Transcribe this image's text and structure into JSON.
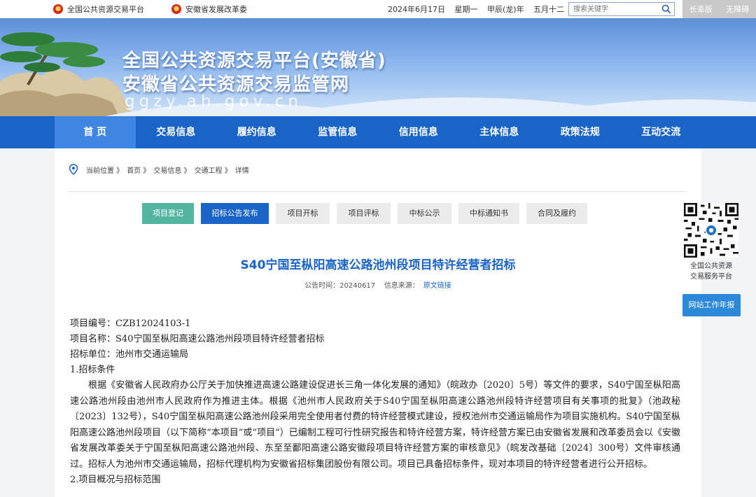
{
  "topbar": {
    "link1": "全国公共资源交易平台",
    "link2": "安徽省发展改革委",
    "date": "2024年6月17日 星期一 甲辰(龙)年 五月十二",
    "search_placeholder": "搜索关键字",
    "elder": "长辈版",
    "accessible": "无障碍"
  },
  "banner": {
    "title1": "全国公共资源交易平台(安徽省)",
    "title2": "安徽省公共资源交易监管网",
    "domain": "ggzy.ah.gov.cn"
  },
  "nav": [
    "首 页",
    "交易信息",
    "履约信息",
    "监管信息",
    "信用信息",
    "主体信息",
    "政策法规",
    "互动交流"
  ],
  "breadcrumb": [
    "当前位置 》",
    "首页 》",
    "交易信息 》",
    "交通工程 》",
    "详情"
  ],
  "steps": [
    "项目登记",
    "招标公告发布",
    "项目开标",
    "项目评标",
    "中标公示",
    "中标通知书",
    "合同及履约"
  ],
  "article": {
    "title": "S40宁国至枞阳高速公路池州段项目特许经营者招标",
    "pub_label": "公告时间：20240617",
    "source_label": "信息来源：",
    "source_link": "原文链接",
    "project_no": "项目编号：CZB12024103-1",
    "project_name": "项目名称：S40宁国至枞阳高速公路池州段项目特许经营者招标",
    "tenderer": "招标单位：池州市交通运输局",
    "section1": "1.招标条件",
    "para1": "根据《安徽省人民政府办公厅关于加快推进高速公路建设促进长三角一体化发展的通知》（皖政办〔2020〕5号）等文件的要求，S40宁国至枞阳高速公路池州段由池州市人民政府作为推进主体。根据《池州市人民政府关于S40宁国至枞阳高速公路池州段特许经营项目有关事项的批复》（池政秘〔2023〕132号），S40宁国至枞阳高速公路池州段采用完全使用者付费的特许经营模式建设，授权池州市交通运输局作为项目实施机构。S40宁国至枞阳高速公路池州段项目（以下简称“本项目”或“项目”）已编制工程可行性研究报告和特许经营方案，特许经营方案已由安徽省发展和改革委员会以《安徽省发展改革委关于宁国至枞阳高速公路池州段、东至至鄱阳高速公路安徽段项目特许经营方案的审核意见》（皖发改基础〔2024〕300号）文件审核通过。招标人为池州市交通运输局，招标代理机构为安徽省招标集团股份有限公司。项目已具备招标条件，现对本项目的特许经营者进行公开招标。",
    "section2": "2.项目概况与招标范围"
  },
  "side": {
    "qr_caption_1": "全国公共资源",
    "qr_caption_2": "交易服务平台",
    "report": "网站工作年报"
  }
}
